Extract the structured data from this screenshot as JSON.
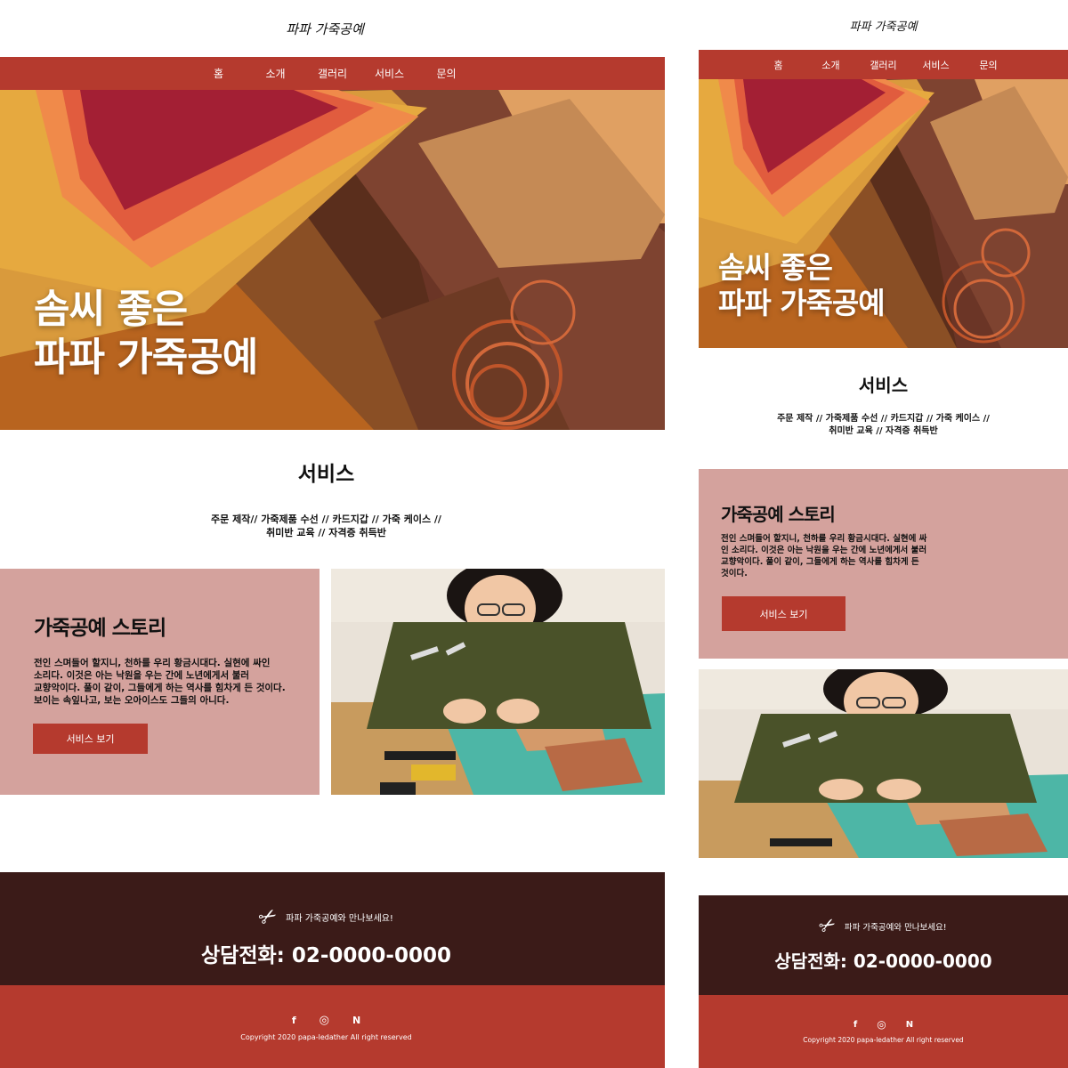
{
  "logo_text": "파파 가죽공예",
  "nav": [
    "홈",
    "소개",
    "갤러리",
    "서비스",
    "문의"
  ],
  "hero": {
    "line1": "솜씨 좋은",
    "line2": "파파 가죽공예"
  },
  "services": {
    "title": "서비스",
    "desktop_line1": "주문 제작// 가죽제품 수선 // 카드지갑 // 가죽 케이스 //",
    "desktop_line2": "취미반 교육 // 자격증 취득반",
    "mobile_line1": "주문 제작 // 가죽제품 수선 // 카드지갑 // 가죽 케이스 //",
    "mobile_line2": "취미반 교육 // 자격증 취득반"
  },
  "story": {
    "title": "가죽공예 스토리",
    "desktop_lines": [
      "전인 스며들어 할지니, 천하를 우리 황금시대다. 실현에 싸인",
      "소리다. 이것은 아는 낙원을 우는 간에 노년에게서 불러",
      "교향악이다. 풀이 같이, 그들에게 하는 역사를 힘차게 든 것이다.",
      "보이는 속잎나고, 보는 오아이스도 그들의 아니다."
    ],
    "mobile_lines": [
      "전인 스며들어 할지니, 천하를 우리 황금시대다. 실현에 싸",
      "인 소리다. 이것은 아는 낙원을 우는 간에 노년에게서 불러",
      "교향악이다. 풀이 같이, 그들에게 하는 역사를 힘차게 든",
      "것이다."
    ],
    "button": "서비스 보기"
  },
  "contact": {
    "tagline": "파파 가죽공예와 만나보세요!",
    "phone": "상담전화: 02-0000-0000"
  },
  "footer": {
    "social": [
      {
        "icon": "facebook-icon",
        "glyph": "f"
      },
      {
        "icon": "instagram-icon",
        "glyph": "◎"
      },
      {
        "icon": "naver-blog-icon",
        "glyph": "N"
      }
    ],
    "copyright": "Copyright 2020 papa-ledather All right reserved"
  },
  "colors": {
    "accent": "#b53a2e",
    "story_bg": "#d4a29d",
    "contact_bg": "#3b1b18"
  }
}
